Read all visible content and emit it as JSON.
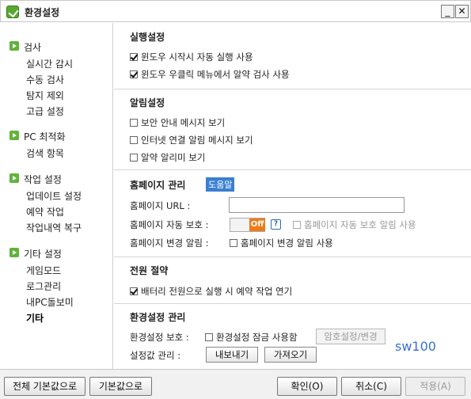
{
  "window": {
    "title": "환경설정",
    "minimize_label": "_",
    "close_label": "✕"
  },
  "sidebar": {
    "groups": [
      {
        "title": "검사",
        "items": [
          "실시간 감시",
          "수동 검사",
          "탐지 제외",
          "고급 설정"
        ]
      },
      {
        "title": "PC 최적화",
        "items": [
          "검색 항목"
        ]
      },
      {
        "title": "작업 설정",
        "items": [
          "업데이트 설정",
          "예약 작업",
          "작업내역 복구"
        ]
      },
      {
        "title": "기타 설정",
        "items": [
          "게임모드",
          "로그관리",
          "내PC돌보미",
          "기타"
        ]
      }
    ]
  },
  "sections": {
    "run": {
      "title": "실행설정",
      "options": [
        {
          "label": "윈도우 시작시 자동 실행 사용",
          "checked": true
        },
        {
          "label": "윈도우 우클릭 메뉴에서 알약 검사 사용",
          "checked": true
        }
      ]
    },
    "notify": {
      "title": "알림설정",
      "options": [
        {
          "label": "보안 안내 메시지 보기",
          "checked": false
        },
        {
          "label": "인터넷 연결 알림 메시지 보기",
          "checked": false
        },
        {
          "label": "알약 알리미 보기",
          "checked": false
        }
      ]
    },
    "homepage": {
      "title": "홈페이지 관리",
      "help_badge": "도움말",
      "url_label": "홈페이지 URL :",
      "url_value": "",
      "protect_label": "홈페이지 자동 보호 :",
      "toggle_state": "Off",
      "help_icon": "?",
      "protect_notify_label": "홈페이지 자동 보호 알림 사용",
      "change_label": "홈페이지 변경 알림 :",
      "change_notify_label": "홈페이지 변경 알림 사용"
    },
    "power": {
      "title": "전원 절약",
      "options": [
        {
          "label": "배터리 전원으로 실행 시 예약 작업 연기",
          "checked": true
        }
      ]
    },
    "manage": {
      "title": "환경설정 관리",
      "protect_label": "환경설정 보호 :",
      "lock_label": "환경설정 잠금 사용함",
      "password_button": "암호설정/변경",
      "values_label": "설정값 관리 :",
      "export_button": "내보내기",
      "import_button": "가져오기",
      "note": "sw100"
    }
  },
  "footer": {
    "reset_all": "전체 기본값으로",
    "reset": "기본값으로",
    "ok": "확인(O)",
    "cancel": "취소(C)",
    "apply": "적용(A)"
  },
  "colors": {
    "accent_green": "#62b23a",
    "toggle_orange": "#ef7b17",
    "link_blue": "#3a7fd0"
  }
}
